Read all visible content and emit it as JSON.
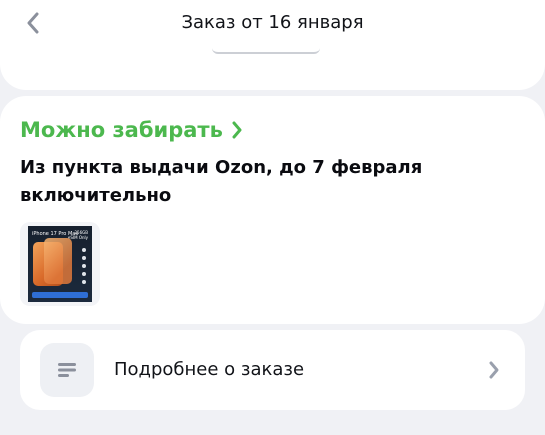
{
  "header": {
    "title": "Заказ от 16 января",
    "back_icon": "chevron-left-icon"
  },
  "status": {
    "title": "Можно забирать",
    "title_icon": "chevron-right-icon",
    "description": "Из пункта выдачи Ozon, до 7 февраля включительно",
    "accent_color": "#4cb84e"
  },
  "product": {
    "image_title": "iPhone 17 Pro Max",
    "image_badge_top": "256GB",
    "image_badge_bottom": "eSIM Only"
  },
  "details": {
    "label": "Подробнее о заказе",
    "icon": "list-lines-icon",
    "chevron_icon": "chevron-right-icon"
  }
}
